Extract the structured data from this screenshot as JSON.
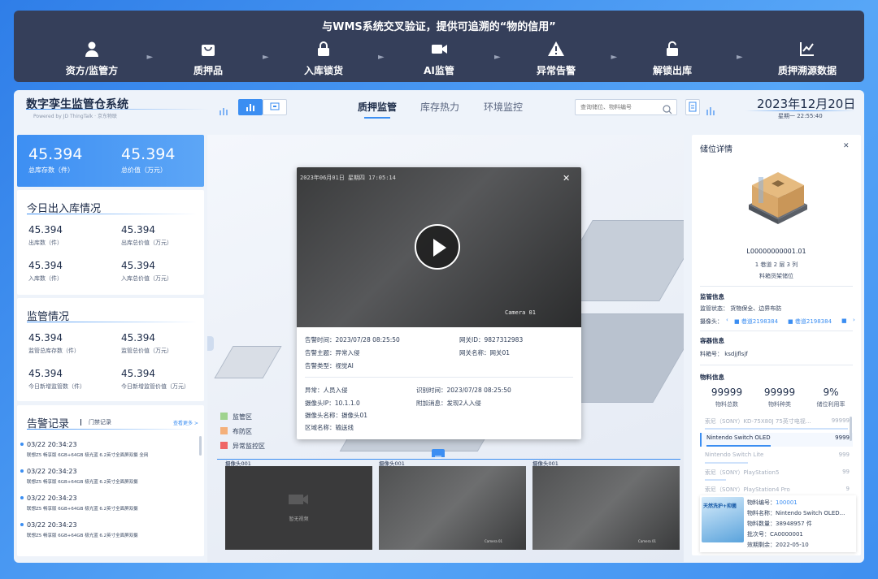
{
  "flow": {
    "title": "与WMS系统交叉验证，提供可追溯的“物的信用”",
    "steps": [
      {
        "label": "资方/监管方",
        "icon": "user-icon"
      },
      {
        "label": "质押品",
        "icon": "bag-icon"
      },
      {
        "label": "入库锁货",
        "icon": "lock-icon"
      },
      {
        "label": "AI监管",
        "icon": "camera-icon"
      },
      {
        "label": "异常告警",
        "icon": "warning-icon"
      },
      {
        "label": "解锁出库",
        "icon": "unlock-icon"
      },
      {
        "label": "质押溯源数据",
        "icon": "chart-icon"
      }
    ]
  },
  "header": {
    "brand": "数字孪生监管仓系统",
    "brand_sub": "Powered by JD ThingTalk · 京东物联",
    "tabs": [
      "质押监管",
      "库存热力",
      "环境监控"
    ],
    "search_placeholder": "查询储位、物料编号",
    "date": "2023年12月20日",
    "weekday_time": "星期一  22:55:40"
  },
  "summary": {
    "v1": "45.394",
    "l1": "总库存数（件）",
    "v2": "45.394",
    "l2": "总价值（万元）"
  },
  "today": {
    "title": "今日出入库情况",
    "items": [
      {
        "value": "45.394",
        "label": "出库数（件）"
      },
      {
        "value": "45.394",
        "label": "出库总价值（万元）"
      },
      {
        "value": "45.394",
        "label": "入库数（件）"
      },
      {
        "value": "45.394",
        "label": "入库总价值（万元）"
      }
    ]
  },
  "supervision": {
    "title": "监管情况",
    "items": [
      {
        "value": "45.394",
        "label": "监管总库存数（件）"
      },
      {
        "value": "45.394",
        "label": "监管总价值（万元）"
      },
      {
        "value": "45.394",
        "label": "今日新增监管数（件）"
      },
      {
        "value": "45.394",
        "label": "今日新增监管价值（万元）"
      }
    ]
  },
  "alarms": {
    "title": "告警记录",
    "subtab": "门禁记录",
    "more": "查看更多 >",
    "items": [
      {
        "time": "03/22    20:34:23",
        "text": "联想Z5 畅享版 6GB+64GB 极光蓝 6.2英寸全面屏双摄 全网"
      },
      {
        "time": "03/22    20:34:23",
        "text": "联想Z5 畅享版 6GB+64GB 极光蓝 6.2英寸全面屏双摄"
      },
      {
        "time": "03/22    20:34:23",
        "text": "联想Z5 畅享版 6GB+64GB 极光蓝 6.2英寸全面屏双摄"
      },
      {
        "time": "03/22    20:34:23",
        "text": "联想Z5 畅享版 6GB+64GB 极光蓝 6.2英寸全面屏双摄"
      }
    ]
  },
  "legend": [
    {
      "label": "监管区",
      "color": "#9fd38f"
    },
    {
      "label": "布防区",
      "color": "#f4b07a"
    },
    {
      "label": "异常监控区",
      "color": "#ef6666"
    }
  ],
  "modal": {
    "video_stamp": "2023年06月01日 星期四 17:05:14",
    "camera_tag": "Camera 01",
    "rows1": [
      {
        "k": "告警时间：",
        "v": "2023/07/28 08:25:50"
      },
      {
        "k": "网关ID：",
        "v": "9827312983"
      },
      {
        "k": "告警主题：",
        "v": "异常入侵"
      },
      {
        "k": "网关名称：",
        "v": "网关01"
      },
      {
        "k": "告警类型：",
        "v": "视觉AI"
      }
    ],
    "rows2": [
      {
        "k": "异常：",
        "v": "人员入侵"
      },
      {
        "k": "识别时间：",
        "v": "2023/07/28 08:25:50"
      },
      {
        "k": "摄像头IP：",
        "v": "10.1.1.0"
      },
      {
        "k": "附加消息：",
        "v": "发现2人入侵"
      },
      {
        "k": "摄像头名称：",
        "v": "摄像头01"
      },
      {
        "k": "区域名称：",
        "v": "输送线"
      }
    ]
  },
  "cameras": [
    {
      "title": "摄像头001",
      "note": "暂无视频",
      "tag": ""
    },
    {
      "title": "摄像头001",
      "note": "",
      "tag": "Camera 01"
    },
    {
      "title": "摄像头001",
      "note": "",
      "tag": "Camera 01"
    }
  ],
  "detail": {
    "title": "储位详情",
    "code": "L00000000001.01",
    "loc": "1 巷道 2 层 3 列",
    "type": "料箱货架储位",
    "sup_h": "监管信息",
    "sup_state": "监管状态：  货物保全、边界布防",
    "cam_label": "摄像头：",
    "cam1": "巷道2198384",
    "cam2": "巷道2198384",
    "cont_h": "容器信息",
    "box": "料箱号：    ksdjjflsjf",
    "mat_h": "物料信息",
    "stats": [
      {
        "v": "99999",
        "l": "物料总数"
      },
      {
        "v": "99999",
        "l": "物料种类"
      },
      {
        "v": "9%",
        "l": "储位利用率"
      }
    ],
    "list": [
      {
        "name": "索尼（SONY）KD-75X80J 75英寸电视…",
        "qty": "99999",
        "fill": 1.0
      },
      {
        "name": "Nintendo Switch OLED",
        "qty": "9999",
        "fill": 0.45
      },
      {
        "name": "Nintendo Switch Lite",
        "qty": "999",
        "fill": 0.3
      },
      {
        "name": "索尼（SONY）PlayStation5",
        "qty": "99",
        "fill": 0.15
      },
      {
        "name": "索尼（SONY）PlayStation4 Pro",
        "qty": "9",
        "fill": 0.05
      }
    ],
    "card": [
      {
        "k": "物料编号：",
        "v": "100001"
      },
      {
        "k": "物料名称：",
        "v": "Nintendo Switch OLED..."
      },
      {
        "k": "物料数量：",
        "v": "38948957 件"
      },
      {
        "k": "批次号：",
        "v": "CA0000001"
      },
      {
        "k": "效期剩余：",
        "v": "2022-05-10"
      }
    ],
    "card_img_text": "天然洗护+抑菌"
  }
}
